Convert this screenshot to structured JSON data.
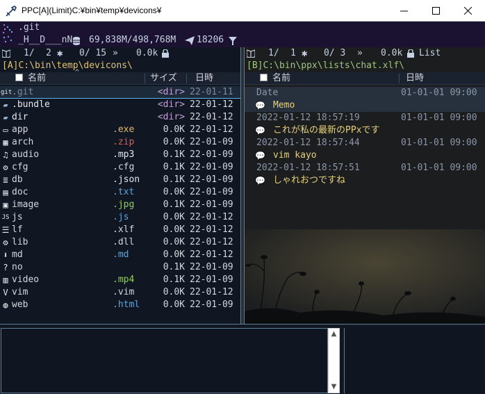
{
  "window": {
    "title": "PPC[A](Limit)C:¥bin¥temp¥devicons¥",
    "minimize_icon": "minimize-icon",
    "maximize_icon": "maximize-icon",
    "close_icon": "close-icon"
  },
  "info": {
    "git_label": ".git",
    "attr": "_H__D___nN",
    "disk": "69,838M/498,768M",
    "count": "18206",
    "icons": [
      "dots-icon",
      "disk-icon",
      "send-icon",
      "filter-icon"
    ]
  },
  "pane_a": {
    "status": {
      "num": "1/",
      "total": "2",
      "mark_count": "0/ 15",
      "size": "0.0k"
    },
    "path": "[A]C:\\bin\\temp\\devicons\\",
    "headers": {
      "name": "名前",
      "size": "サイズ",
      "date": "日時"
    },
    "files": [
      {
        "icon": "git-icon",
        "icon_text": "git",
        "name": ".git",
        "ext": "",
        "size": "<dir>",
        "date": "22-01-11",
        "state": "cursor"
      },
      {
        "icon": "folder-icon",
        "icon_text": "▰",
        "name": ".bundle",
        "ext": "",
        "size": "<dir>",
        "date": "22-01-12",
        "state": "dir"
      },
      {
        "icon": "folder-icon",
        "icon_text": "▰",
        "name": "dir",
        "ext": "",
        "size": "<dir>",
        "date": "22-01-12",
        "state": "dir"
      },
      {
        "icon": "app-icon",
        "icon_text": "▭",
        "name": "app",
        "ext": ".exe",
        "ext_class": "exe",
        "size": "0.0K",
        "date": "22-01-12"
      },
      {
        "icon": "archive-icon",
        "icon_text": "▦",
        "name": "arch",
        "ext": ".zip",
        "ext_class": "zip",
        "size": "0.0K",
        "date": "22-01-09"
      },
      {
        "icon": "music-icon",
        "icon_text": "♫",
        "name": "audio",
        "ext": ".mp3",
        "ext_class": "mp3",
        "size": "0.1K",
        "date": "22-01-09"
      },
      {
        "icon": "gear-icon",
        "icon_text": "⚙",
        "name": "cfg",
        "ext": ".cfg",
        "ext_class": "cfg",
        "size": "0.1K",
        "date": "22-01-09"
      },
      {
        "icon": "database-icon",
        "icon_text": "≣",
        "name": "db",
        "ext": ".json",
        "ext_class": "json",
        "size": "0.1K",
        "date": "22-01-09"
      },
      {
        "icon": "document-icon",
        "icon_text": "▤",
        "name": "doc",
        "ext": ".txt",
        "ext_class": "txt",
        "size": "0.0K",
        "date": "22-01-09"
      },
      {
        "icon": "image-icon",
        "icon_text": "▣",
        "name": "image",
        "ext": ".jpg",
        "ext_class": "jpg",
        "size": "0.1K",
        "date": "22-01-09"
      },
      {
        "icon": "js-icon",
        "icon_text": "JS",
        "name": "js",
        "ext": ".js",
        "ext_class": "js",
        "size": "0.0K",
        "date": "22-01-12"
      },
      {
        "icon": "list-icon",
        "icon_text": "☰",
        "name": "lf",
        "ext": ".xlf",
        "ext_class": "xlf",
        "size": "0.0K",
        "date": "22-01-12"
      },
      {
        "icon": "gears-icon",
        "icon_text": "⚙",
        "name": "lib",
        "ext": ".dll",
        "ext_class": "dll",
        "size": "0.0K",
        "date": "22-01-12"
      },
      {
        "icon": "markdown-icon",
        "icon_text": "⬇",
        "name": "md",
        "ext": ".md",
        "ext_class": "md",
        "size": "0.0K",
        "date": "22-01-12"
      },
      {
        "icon": "question-icon",
        "icon_text": "?",
        "name": "no",
        "ext": "",
        "ext_class": "",
        "size": "0.1K",
        "date": "22-01-09"
      },
      {
        "icon": "film-icon",
        "icon_text": "▥",
        "name": "video",
        "ext": ".mp4",
        "ext_class": "mp4",
        "size": "0.1K",
        "date": "22-01-09"
      },
      {
        "icon": "vim-icon",
        "icon_text": "V",
        "name": "vim",
        "ext": ".vim",
        "ext_class": "vim",
        "size": "0.0K",
        "date": "22-01-12"
      },
      {
        "icon": "globe-icon",
        "icon_text": "◍",
        "name": "web",
        "ext": ".html",
        "ext_class": "html",
        "size": "0.0K",
        "date": "22-01-09"
      }
    ]
  },
  "pane_b": {
    "status": {
      "num": "1/",
      "total": "1",
      "mark_count": "0/ 3",
      "size": "0.0k",
      "mode": "List"
    },
    "path": "[B]C:\\bin\\ppx\\lists\\chat.xlf\\",
    "headers": {
      "name": "名前",
      "date": "日時"
    },
    "entries": [
      {
        "title": "Date",
        "date": "01-01-01 09:00",
        "message": "Memo"
      },
      {
        "title": "2022-01-12 18:57:19",
        "date": "01-01-01 09:00",
        "message": "これが私の最新のPPxです"
      },
      {
        "title": "2022-01-12 18:57:44",
        "date": "01-01-01 09:00",
        "message": "vim kayo"
      },
      {
        "title": "2022-01-12 18:57:51",
        "date": "01-01-01 09:00",
        "message": "しゃれおつですね"
      }
    ]
  },
  "colors": {
    "accent": "#5db1e6",
    "path": "#e2c36a",
    "chat_message": "#e6d27a"
  }
}
